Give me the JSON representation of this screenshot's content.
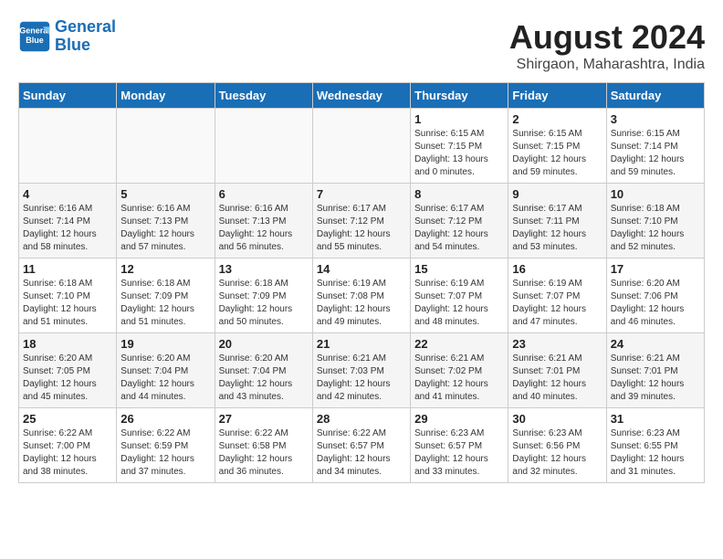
{
  "logo": {
    "line1": "General",
    "line2": "Blue"
  },
  "title": "August 2024",
  "subtitle": "Shirgaon, Maharashtra, India",
  "weekdays": [
    "Sunday",
    "Monday",
    "Tuesday",
    "Wednesday",
    "Thursday",
    "Friday",
    "Saturday"
  ],
  "weeks": [
    [
      {
        "day": "",
        "info": ""
      },
      {
        "day": "",
        "info": ""
      },
      {
        "day": "",
        "info": ""
      },
      {
        "day": "",
        "info": ""
      },
      {
        "day": "1",
        "info": "Sunrise: 6:15 AM\nSunset: 7:15 PM\nDaylight: 13 hours\nand 0 minutes."
      },
      {
        "day": "2",
        "info": "Sunrise: 6:15 AM\nSunset: 7:15 PM\nDaylight: 12 hours\nand 59 minutes."
      },
      {
        "day": "3",
        "info": "Sunrise: 6:15 AM\nSunset: 7:14 PM\nDaylight: 12 hours\nand 59 minutes."
      }
    ],
    [
      {
        "day": "4",
        "info": "Sunrise: 6:16 AM\nSunset: 7:14 PM\nDaylight: 12 hours\nand 58 minutes."
      },
      {
        "day": "5",
        "info": "Sunrise: 6:16 AM\nSunset: 7:13 PM\nDaylight: 12 hours\nand 57 minutes."
      },
      {
        "day": "6",
        "info": "Sunrise: 6:16 AM\nSunset: 7:13 PM\nDaylight: 12 hours\nand 56 minutes."
      },
      {
        "day": "7",
        "info": "Sunrise: 6:17 AM\nSunset: 7:12 PM\nDaylight: 12 hours\nand 55 minutes."
      },
      {
        "day": "8",
        "info": "Sunrise: 6:17 AM\nSunset: 7:12 PM\nDaylight: 12 hours\nand 54 minutes."
      },
      {
        "day": "9",
        "info": "Sunrise: 6:17 AM\nSunset: 7:11 PM\nDaylight: 12 hours\nand 53 minutes."
      },
      {
        "day": "10",
        "info": "Sunrise: 6:18 AM\nSunset: 7:10 PM\nDaylight: 12 hours\nand 52 minutes."
      }
    ],
    [
      {
        "day": "11",
        "info": "Sunrise: 6:18 AM\nSunset: 7:10 PM\nDaylight: 12 hours\nand 51 minutes."
      },
      {
        "day": "12",
        "info": "Sunrise: 6:18 AM\nSunset: 7:09 PM\nDaylight: 12 hours\nand 51 minutes."
      },
      {
        "day": "13",
        "info": "Sunrise: 6:18 AM\nSunset: 7:09 PM\nDaylight: 12 hours\nand 50 minutes."
      },
      {
        "day": "14",
        "info": "Sunrise: 6:19 AM\nSunset: 7:08 PM\nDaylight: 12 hours\nand 49 minutes."
      },
      {
        "day": "15",
        "info": "Sunrise: 6:19 AM\nSunset: 7:07 PM\nDaylight: 12 hours\nand 48 minutes."
      },
      {
        "day": "16",
        "info": "Sunrise: 6:19 AM\nSunset: 7:07 PM\nDaylight: 12 hours\nand 47 minutes."
      },
      {
        "day": "17",
        "info": "Sunrise: 6:20 AM\nSunset: 7:06 PM\nDaylight: 12 hours\nand 46 minutes."
      }
    ],
    [
      {
        "day": "18",
        "info": "Sunrise: 6:20 AM\nSunset: 7:05 PM\nDaylight: 12 hours\nand 45 minutes."
      },
      {
        "day": "19",
        "info": "Sunrise: 6:20 AM\nSunset: 7:04 PM\nDaylight: 12 hours\nand 44 minutes."
      },
      {
        "day": "20",
        "info": "Sunrise: 6:20 AM\nSunset: 7:04 PM\nDaylight: 12 hours\nand 43 minutes."
      },
      {
        "day": "21",
        "info": "Sunrise: 6:21 AM\nSunset: 7:03 PM\nDaylight: 12 hours\nand 42 minutes."
      },
      {
        "day": "22",
        "info": "Sunrise: 6:21 AM\nSunset: 7:02 PM\nDaylight: 12 hours\nand 41 minutes."
      },
      {
        "day": "23",
        "info": "Sunrise: 6:21 AM\nSunset: 7:01 PM\nDaylight: 12 hours\nand 40 minutes."
      },
      {
        "day": "24",
        "info": "Sunrise: 6:21 AM\nSunset: 7:01 PM\nDaylight: 12 hours\nand 39 minutes."
      }
    ],
    [
      {
        "day": "25",
        "info": "Sunrise: 6:22 AM\nSunset: 7:00 PM\nDaylight: 12 hours\nand 38 minutes."
      },
      {
        "day": "26",
        "info": "Sunrise: 6:22 AM\nSunset: 6:59 PM\nDaylight: 12 hours\nand 37 minutes."
      },
      {
        "day": "27",
        "info": "Sunrise: 6:22 AM\nSunset: 6:58 PM\nDaylight: 12 hours\nand 36 minutes."
      },
      {
        "day": "28",
        "info": "Sunrise: 6:22 AM\nSunset: 6:57 PM\nDaylight: 12 hours\nand 34 minutes."
      },
      {
        "day": "29",
        "info": "Sunrise: 6:23 AM\nSunset: 6:57 PM\nDaylight: 12 hours\nand 33 minutes."
      },
      {
        "day": "30",
        "info": "Sunrise: 6:23 AM\nSunset: 6:56 PM\nDaylight: 12 hours\nand 32 minutes."
      },
      {
        "day": "31",
        "info": "Sunrise: 6:23 AM\nSunset: 6:55 PM\nDaylight: 12 hours\nand 31 minutes."
      }
    ]
  ]
}
